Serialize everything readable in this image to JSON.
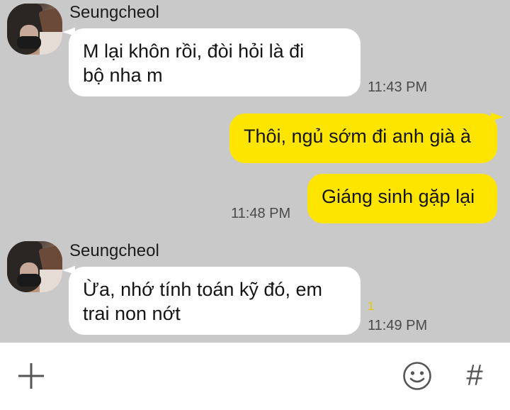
{
  "messages": [
    {
      "sender": "Seungcheol",
      "text": "M lại khôn rồi, đòi hỏi là đi bộ nha m",
      "lines": [
        "M lại khôn rồi, đòi hỏi là đi",
        "bộ nha m"
      ],
      "time": "11:43 PM"
    },
    {
      "sender": "me",
      "text": "Thôi, ngủ sớm đi anh già à"
    },
    {
      "sender": "me",
      "text": "Giáng sinh gặp lại",
      "time": "11:48 PM"
    },
    {
      "sender": "Seungcheol",
      "text": "Ừa, nhớ tính toán kỹ đó, em trai non nớt",
      "lines": [
        "Ừa, nhớ tính toán kỹ đó, em",
        "trai non nớt"
      ],
      "time": "11:49 PM",
      "unread": "1"
    }
  ],
  "input": {
    "icons": [
      "plus-icon",
      "emoji-icon",
      "hash-icon"
    ],
    "hash_glyph": "#"
  },
  "colors": {
    "chat_background": "#c9c9c9",
    "my_bubble": "#fee500",
    "their_bubble": "#ffffff",
    "unread_count": "#e8c900"
  }
}
